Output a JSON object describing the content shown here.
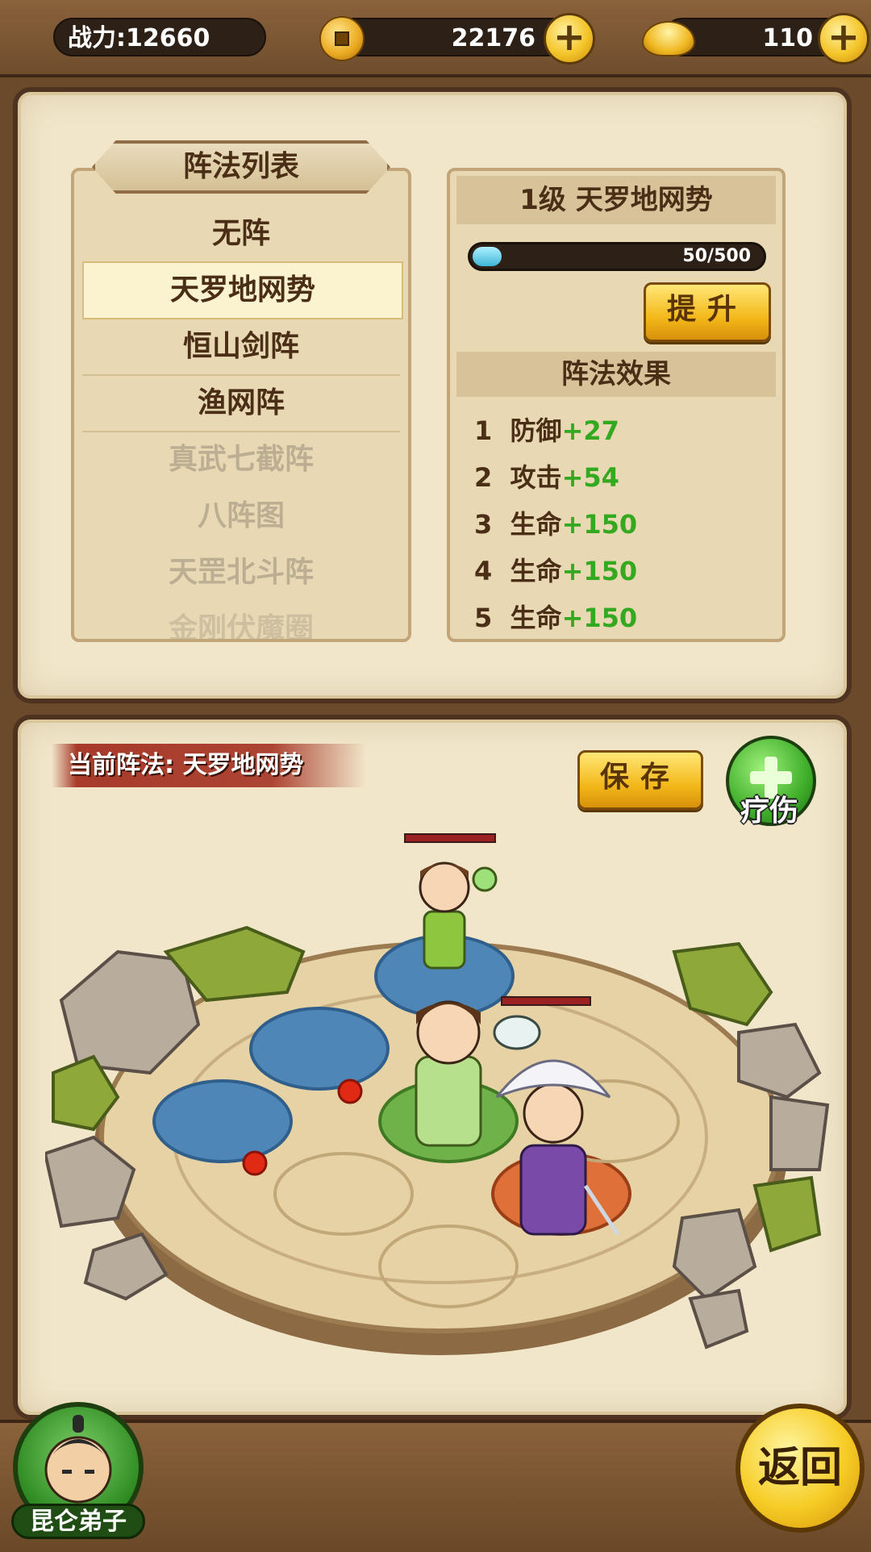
{
  "topbar": {
    "power": "战力:12660",
    "coins": "22176",
    "gold": "110",
    "plus_symbol": "+"
  },
  "formation_list": {
    "title": "阵法列表",
    "items": [
      {
        "label": "无阵",
        "state": "normal"
      },
      {
        "label": "天罗地网势",
        "state": "selected"
      },
      {
        "label": "恒山剑阵",
        "state": "normal"
      },
      {
        "label": "渔网阵",
        "state": "normal"
      },
      {
        "label": "真武七截阵",
        "state": "locked"
      },
      {
        "label": "八阵图",
        "state": "locked"
      },
      {
        "label": "天罡北斗阵",
        "state": "locked"
      },
      {
        "label": "金刚伏魔圈",
        "state": "locked"
      }
    ]
  },
  "formation_info": {
    "title": "1级 天罗地网势",
    "progress_text": "50/500",
    "progress_value": 0.1,
    "upgrade_label": "提升",
    "effects_title": "阵法效果",
    "effects": [
      {
        "index": "1",
        "stat": "防御",
        "bonus": "+27"
      },
      {
        "index": "2",
        "stat": "攻击",
        "bonus": "+54"
      },
      {
        "index": "3",
        "stat": "生命",
        "bonus": "+150"
      },
      {
        "index": "4",
        "stat": "生命",
        "bonus": "+150"
      },
      {
        "index": "5",
        "stat": "生命",
        "bonus": "+150"
      }
    ]
  },
  "arena": {
    "current_formation": "当前阵法: 天罗地网势",
    "save_label": "保存",
    "heal_label": "疗伤"
  },
  "footer": {
    "player_name": "昆仑弟子",
    "return_label": "返回"
  },
  "colors": {
    "bonus_green": "#34a81e",
    "blue_slot": "#4f86b8",
    "green_slot": "#6fb24a",
    "orange_slot": "#e0703a"
  }
}
